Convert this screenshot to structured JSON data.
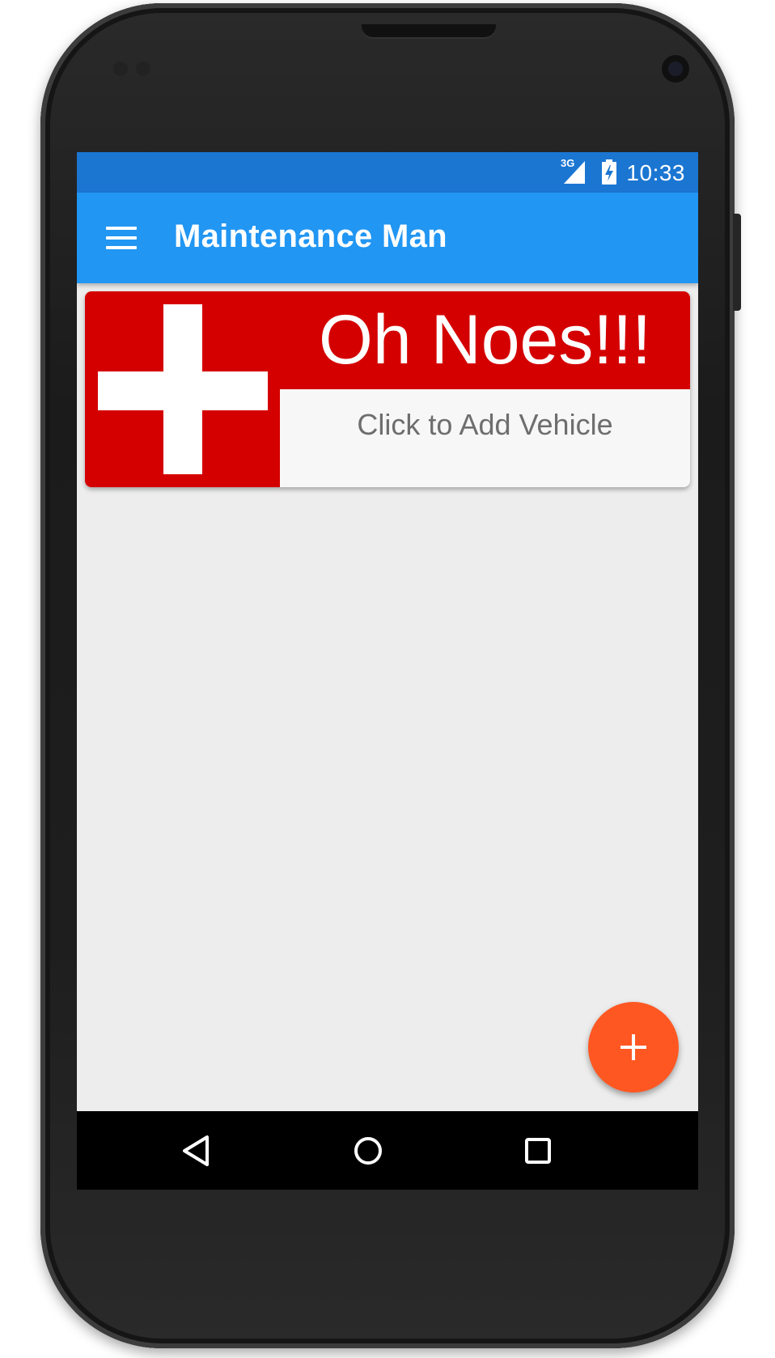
{
  "status_bar": {
    "network_label": "3G",
    "time": "10:33"
  },
  "app_bar": {
    "title": "Maintenance Man",
    "nav_icon": "hamburger-menu-icon"
  },
  "empty_card": {
    "title": "Oh Noes!!!",
    "subtitle": "Click to Add Vehicle",
    "image_icon": "red-cross-icon"
  },
  "fab": {
    "icon": "plus-icon"
  },
  "navigation_bar": {
    "buttons": [
      "back-icon",
      "home-icon",
      "recents-icon"
    ]
  },
  "colors": {
    "status_bar": "#1b76d2",
    "app_bar": "#2196f3",
    "card_red": "#d40000",
    "fab": "#ff5722",
    "background": "#ededed"
  }
}
